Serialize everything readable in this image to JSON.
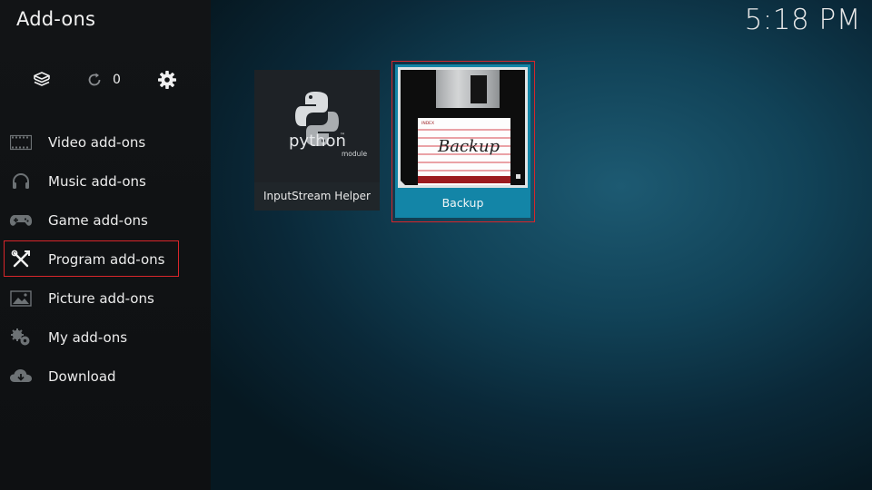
{
  "window": {
    "title": "Add-ons",
    "clock": "5:18 PM"
  },
  "toolbar": {
    "icons": [
      "addon-box-icon",
      "refresh-icon",
      "gear-icon"
    ],
    "update_count": "0"
  },
  "sidebar": {
    "items": [
      {
        "label": "Video add-ons",
        "icon": "film-icon",
        "selected": false
      },
      {
        "label": "Music add-ons",
        "icon": "headphones-icon",
        "selected": false
      },
      {
        "label": "Game add-ons",
        "icon": "gamepad-icon",
        "selected": false
      },
      {
        "label": "Program add-ons",
        "icon": "tools-icon",
        "selected": true
      },
      {
        "label": "Picture add-ons",
        "icon": "picture-icon",
        "selected": false
      },
      {
        "label": "My add-ons",
        "icon": "puzzle-icon",
        "selected": false
      },
      {
        "label": "Download",
        "icon": "cloud-download-icon",
        "selected": false
      }
    ]
  },
  "addons": [
    {
      "name": "InputStream Helper",
      "thumb": {
        "word": "python",
        "tm": "™",
        "sub": "module"
      },
      "focused": false
    },
    {
      "name": "Backup",
      "thumb": {
        "index": "INDEX",
        "word": "Backup"
      },
      "focused": true
    }
  ],
  "colors": {
    "accent": "#1385a7",
    "selection_border": "#d8262b",
    "sidebar": "#121416"
  }
}
